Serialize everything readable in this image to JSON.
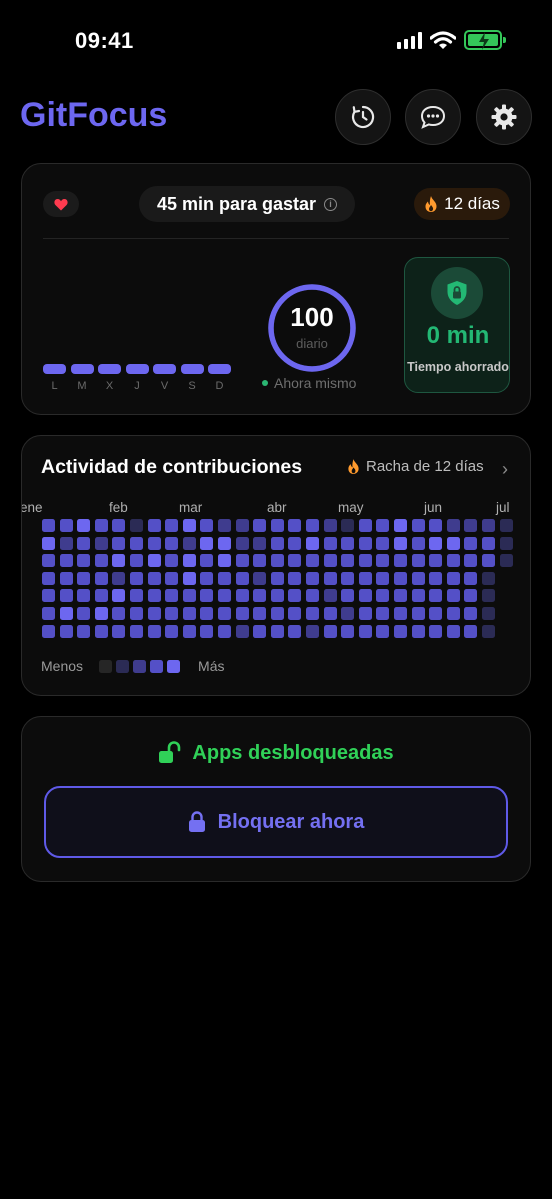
{
  "status_bar": {
    "time": "09:41"
  },
  "header": {
    "app_title": "GitFocus",
    "buttons": [
      "history-icon",
      "chat-icon",
      "gear-icon"
    ]
  },
  "summary": {
    "budget_label": "45 min para gastar",
    "streak_label": "12 días",
    "weekdays": [
      "L",
      "M",
      "X",
      "J",
      "V",
      "S",
      "D"
    ],
    "score": "100",
    "score_caption": "diario",
    "score_status": "Ahora mismo",
    "score_progress_fraction": 1.0,
    "saved_value": "0 min",
    "saved_label": "Tiempo ahorrado",
    "colors": {
      "accent": "#6d67f0",
      "green": "#23b874",
      "heart": "#ff3b4f",
      "flame": "#ff9a2e"
    }
  },
  "activity": {
    "title": "Actividad de contribuciones",
    "streak_label": "Racha de 12 días",
    "months": [
      "ene",
      "feb",
      "mar",
      "abr",
      "may",
      "jun",
      "jul"
    ],
    "levels_by_week": [
      [
        3,
        4,
        3,
        3,
        3,
        3,
        3
      ],
      [
        3,
        2,
        3,
        3,
        3,
        4,
        3
      ],
      [
        4,
        3,
        3,
        3,
        3,
        3,
        3
      ],
      [
        3,
        2,
        3,
        3,
        3,
        4,
        3
      ],
      [
        3,
        3,
        4,
        2,
        4,
        3,
        3
      ],
      [
        1,
        3,
        3,
        3,
        3,
        3,
        3
      ],
      [
        3,
        3,
        4,
        3,
        3,
        3,
        3
      ],
      [
        3,
        3,
        3,
        3,
        3,
        3,
        3
      ],
      [
        4,
        2,
        4,
        4,
        3,
        3,
        3
      ],
      [
        3,
        4,
        3,
        3,
        3,
        3,
        3
      ],
      [
        2,
        4,
        4,
        3,
        3,
        3,
        3
      ],
      [
        2,
        2,
        3,
        3,
        3,
        3,
        2
      ],
      [
        3,
        2,
        3,
        2,
        3,
        3,
        3
      ],
      [
        3,
        3,
        3,
        3,
        3,
        3,
        3
      ],
      [
        3,
        3,
        3,
        3,
        3,
        3,
        3
      ],
      [
        3,
        4,
        3,
        3,
        3,
        3,
        2
      ],
      [
        2,
        3,
        3,
        3,
        2,
        3,
        3
      ],
      [
        1,
        3,
        3,
        3,
        3,
        2,
        3
      ],
      [
        3,
        3,
        3,
        3,
        3,
        3,
        3
      ],
      [
        3,
        3,
        3,
        3,
        3,
        3,
        3
      ],
      [
        4,
        4,
        3,
        3,
        3,
        3,
        3
      ],
      [
        3,
        3,
        3,
        3,
        3,
        3,
        3
      ],
      [
        3,
        4,
        3,
        3,
        3,
        3,
        3
      ],
      [
        2,
        4,
        3,
        3,
        3,
        3,
        3
      ],
      [
        2,
        3,
        3,
        3,
        3,
        3,
        3
      ],
      [
        2,
        3,
        3,
        1,
        1,
        1,
        1
      ],
      [
        1,
        1,
        1
      ]
    ],
    "legend_less": "Menos",
    "legend_more": "Más",
    "level_colors": [
      "#262626",
      "#2b2b55",
      "#3f3c8e",
      "#5450c7",
      "#6d67f0"
    ]
  },
  "lock_card": {
    "status": "Apps desbloqueadas",
    "button_label": "Bloquear ahora"
  }
}
